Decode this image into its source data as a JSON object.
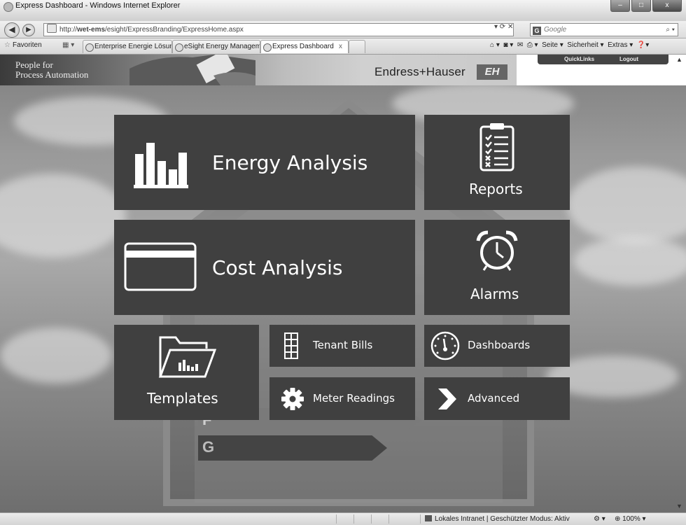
{
  "window": {
    "title": "Express Dashboard - Windows Internet Explorer",
    "buttons": [
      "–",
      "□",
      "x"
    ]
  },
  "address": {
    "url_prefix": "http://",
    "url_host": "wet-ems",
    "url_path": "/esight/ExpressBranding/ExpressHome.aspx",
    "search_placeholder": "Google"
  },
  "tabsbar": {
    "favorites_label": "Favoriten",
    "tabs": [
      {
        "label": "Enterprise Energie Lösung ..."
      },
      {
        "label": "eSight Energy Manageme..."
      },
      {
        "label": "Express Dashboard"
      }
    ],
    "commands": [
      "Seite ▾",
      "Sicherheit ▾",
      "Extras ▾"
    ]
  },
  "header": {
    "tagline_line1": "People for",
    "tagline_line2": "Process Automation",
    "brand": "Endress+Hauser",
    "brand_mark": "EH",
    "quicklinks": "QuickLinks",
    "logout": "Logout"
  },
  "background": {
    "grade_f": "F",
    "grade_g": "G"
  },
  "tiles": {
    "energy": "Energy Analysis",
    "reports": "Reports",
    "cost": "Cost Analysis",
    "alarms": "Alarms",
    "templates": "Templates",
    "tenant": "Tenant Bills",
    "dashboards": "Dashboards",
    "meter": "Meter Readings",
    "advanced": "Advanced"
  },
  "statusbar": {
    "zone": "Lokales Intranet | Geschützter Modus: Aktiv",
    "zoom": "100%"
  }
}
